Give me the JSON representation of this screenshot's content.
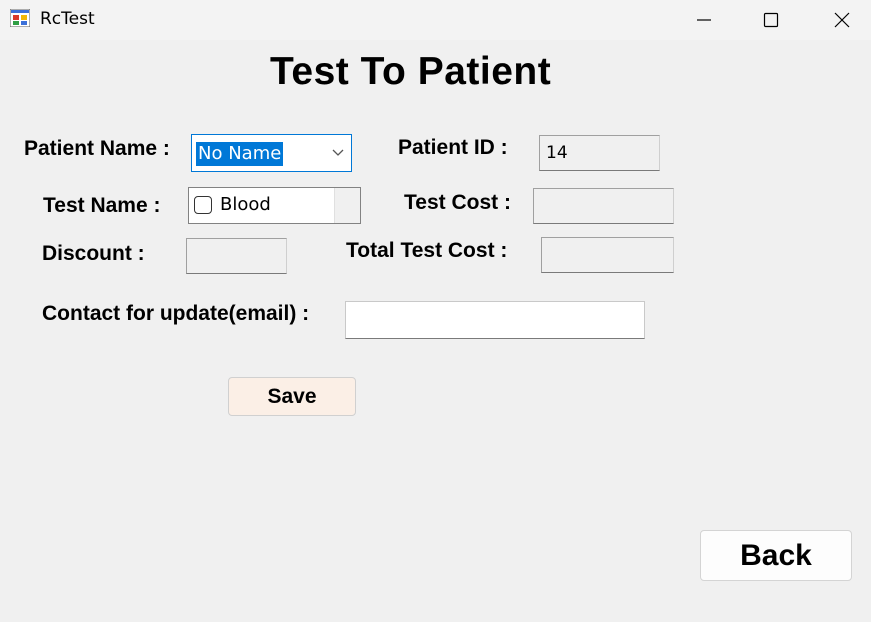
{
  "window": {
    "title": "RcTest",
    "icon": "app-form-icon",
    "controls": [
      "minimize-icon",
      "maximize-icon",
      "close-icon"
    ]
  },
  "form": {
    "heading": "Test To Patient",
    "patient_name": {
      "label": "Patient Name :",
      "selected": "No Name"
    },
    "patient_id": {
      "label": "Patient ID :",
      "value": "14"
    },
    "test_name": {
      "label": "Test Name :",
      "options": [
        {
          "label": "Blood",
          "checked": false
        }
      ]
    },
    "test_cost": {
      "label": "Test Cost :",
      "value": ""
    },
    "discount": {
      "label": "Discount :",
      "value": ""
    },
    "total_test_cost": {
      "label": "Total Test Cost :",
      "value": ""
    },
    "email": {
      "label": "Contact for update(email) :",
      "value": ""
    },
    "save_label": "Save",
    "back_label": "Back"
  },
  "colors": {
    "background": "#f0f0f0",
    "accent": "#0078d7",
    "save_button": "#fbefe6"
  }
}
